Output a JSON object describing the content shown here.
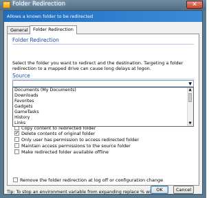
{
  "window": {
    "title": "Folder Redirection",
    "close_symbol": "✕",
    "banner": "Allows a known folder to be redirected"
  },
  "tabs": [
    {
      "label": "General",
      "active": false
    },
    {
      "label": "Folder Redirection",
      "active": true
    }
  ],
  "panel": {
    "heading": "Folder Redirection",
    "description": "Select the folder you want to redirect and the destination. Targeting a folder redirection to a mapped drive can cause long delays at logon.",
    "source_label": "Source",
    "source_value": ""
  },
  "dropdown_items": [
    "Documents (My Documents)",
    "Downloads",
    "Favorites",
    "Gadgets",
    "GameTasks",
    "History",
    "Links"
  ],
  "checkboxes": [
    {
      "label": "Copy content to redirected folder",
      "checked": false
    },
    {
      "label": "Delete contents of original folder",
      "checked": true
    },
    {
      "label": "Only user has permission to access redirected folder",
      "checked": false
    },
    {
      "label": "Maintain access permissions to the source folder",
      "checked": false
    },
    {
      "label": "Make redirected folder available offline",
      "checked": false
    },
    {
      "label": "Remove the folder redirection at log off or configuration change",
      "checked": false
    }
  ],
  "footer": {
    "tip": "Tip: To stop an environment variable from expanding replace % with %%.",
    "ok_label": "OK",
    "cancel_label": "Cancel"
  },
  "colors": {
    "banner": "#1f6fc2",
    "heading": "#1e4fa0",
    "titlebar": "#5b7a8f"
  }
}
